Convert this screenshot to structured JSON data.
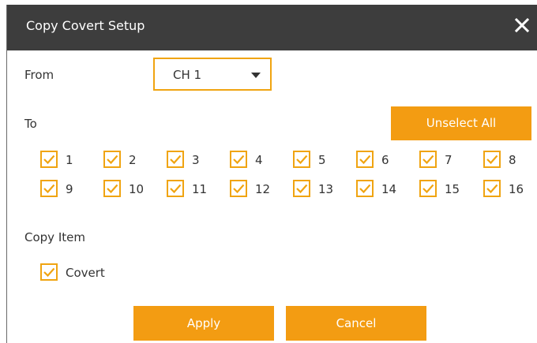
{
  "dialog": {
    "title": "Copy Covert Setup",
    "close_icon": "close-icon"
  },
  "from": {
    "label": "From",
    "selected": "CH 1",
    "dropdown_icon": "caret-down-icon"
  },
  "to": {
    "label": "To",
    "unselect_all_label": "Unselect All",
    "channels": [
      {
        "label": "1",
        "checked": true
      },
      {
        "label": "2",
        "checked": true
      },
      {
        "label": "3",
        "checked": true
      },
      {
        "label": "4",
        "checked": true
      },
      {
        "label": "5",
        "checked": true
      },
      {
        "label": "6",
        "checked": true
      },
      {
        "label": "7",
        "checked": true
      },
      {
        "label": "8",
        "checked": true
      },
      {
        "label": "9",
        "checked": true
      },
      {
        "label": "10",
        "checked": true
      },
      {
        "label": "11",
        "checked": true
      },
      {
        "label": "12",
        "checked": true
      },
      {
        "label": "13",
        "checked": true
      },
      {
        "label": "14",
        "checked": true
      },
      {
        "label": "15",
        "checked": true
      },
      {
        "label": "16",
        "checked": true
      }
    ]
  },
  "copy_item": {
    "label": "Copy Item",
    "covert_label": "Covert",
    "covert_checked": true
  },
  "footer": {
    "apply_label": "Apply",
    "cancel_label": "Cancel"
  },
  "colors": {
    "accent": "#f39c12",
    "checkbox_border": "#f0a411",
    "titlebar": "#3d3d3d"
  }
}
